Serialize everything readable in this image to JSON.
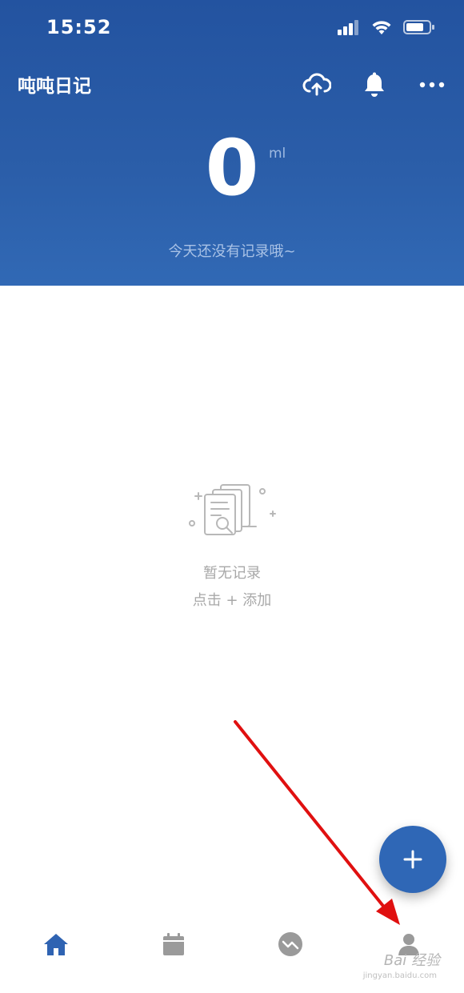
{
  "status_bar": {
    "time": "15:52"
  },
  "app": {
    "title": "吨吨日记"
  },
  "top_actions": [
    "cloud-upload-icon",
    "bell-icon",
    "more-icon"
  ],
  "summary": {
    "amount": "0",
    "unit": "ml",
    "message": "今天还没有记录哦~"
  },
  "empty_state": {
    "title": "暂无记录",
    "hint": "点击 + 添加"
  },
  "fab": {
    "icon": "plus-icon"
  },
  "tabs": [
    {
      "id": "home",
      "icon": "home-icon",
      "active": true
    },
    {
      "id": "calendar",
      "icon": "calendar-icon",
      "active": false
    },
    {
      "id": "stats",
      "icon": "trend-icon",
      "active": false
    },
    {
      "id": "profile",
      "icon": "person-icon",
      "active": false
    }
  ],
  "watermark": {
    "text": "Bai 经验",
    "url": "jingyan.baidu.com"
  },
  "colors": {
    "primary": "#2b5ea9",
    "tab_active": "#2f63b2",
    "tab_inactive": "#9a9a9a",
    "annotation_arrow": "#e01010"
  }
}
